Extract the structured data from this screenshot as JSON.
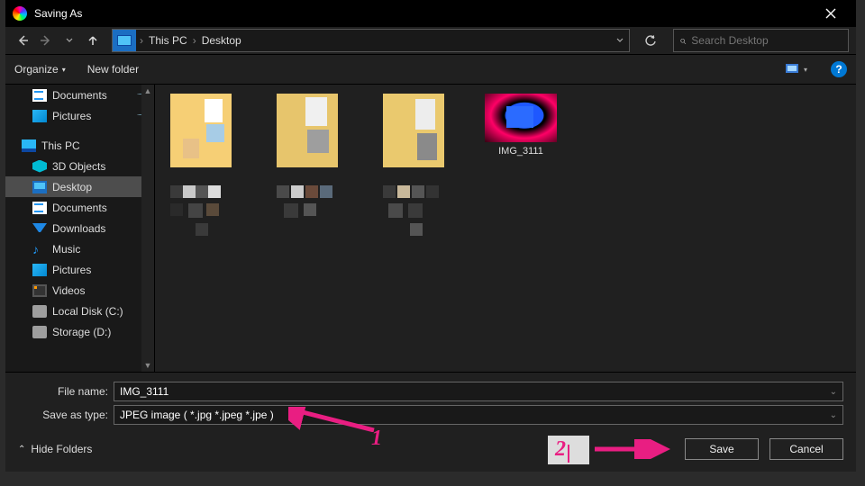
{
  "titlebar": {
    "title": "Saving As"
  },
  "breadcrumb": {
    "a": "This PC",
    "b": "Desktop"
  },
  "search": {
    "placeholder": "Search Desktop"
  },
  "toolbar": {
    "organize": "Organize",
    "newfolder": "New folder"
  },
  "sidebar": {
    "items": [
      {
        "label": "Documents",
        "pinned": true
      },
      {
        "label": "Pictures",
        "pinned": true
      },
      {
        "label": "This PC"
      },
      {
        "label": "3D Objects"
      },
      {
        "label": "Desktop",
        "selected": true
      },
      {
        "label": "Documents"
      },
      {
        "label": "Downloads"
      },
      {
        "label": "Music"
      },
      {
        "label": "Pictures"
      },
      {
        "label": "Videos"
      },
      {
        "label": "Local Disk (C:)"
      },
      {
        "label": "Storage (D:)"
      }
    ]
  },
  "files": {
    "img_label": "IMG_3111"
  },
  "fields": {
    "filename_label": "File name:",
    "filename_value": "IMG_3111",
    "type_label": "Save as type:",
    "type_value": "JPEG image ( *.jpg *.jpeg *.jpe )"
  },
  "footer": {
    "hide": "Hide Folders",
    "save": "Save",
    "cancel": "Cancel"
  },
  "anno": {
    "one": "1",
    "two": "2"
  }
}
